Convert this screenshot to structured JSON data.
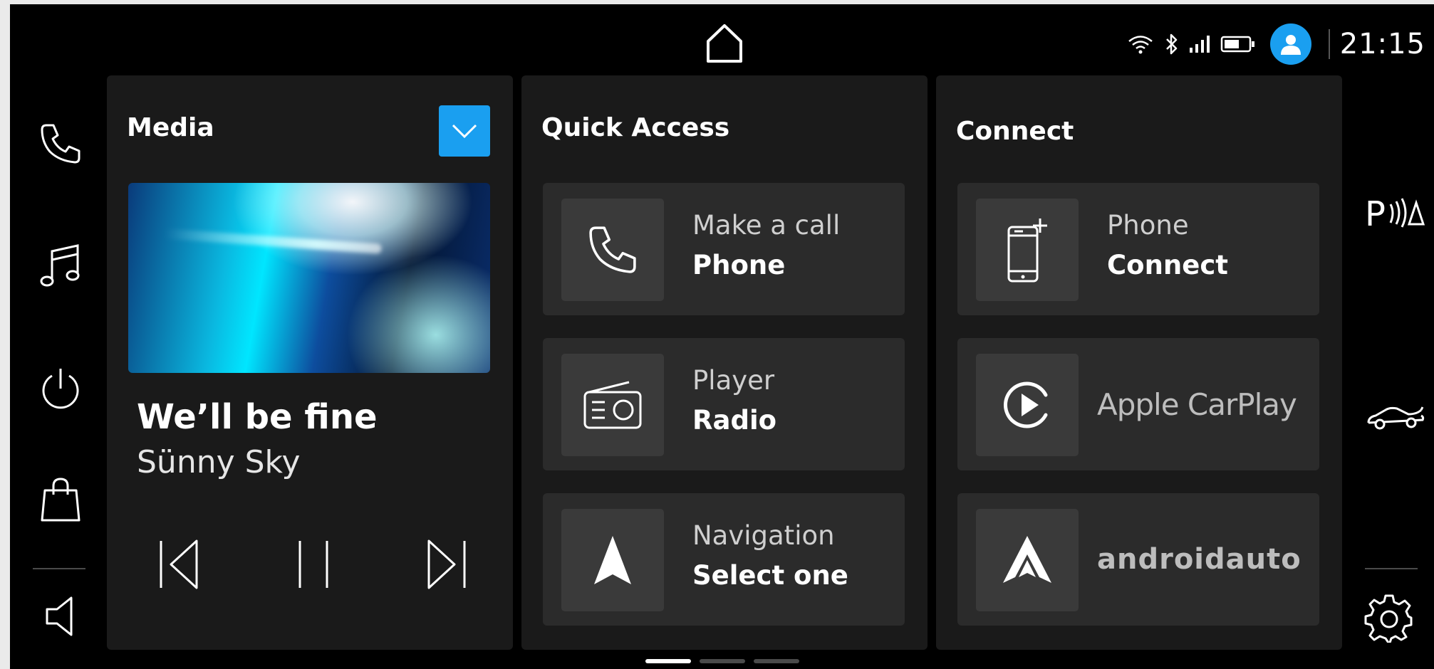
{
  "status": {
    "time": "21:15",
    "icons": [
      "wifi-icon",
      "bluetooth-icon",
      "cellular-signal-icon",
      "battery-icon",
      "user-avatar-icon"
    ]
  },
  "nav": {
    "home_icon": "home-icon",
    "left_rail": [
      "phone-icon",
      "music-note-icon",
      "power-icon",
      "shopping-bag-icon",
      "volume-icon"
    ],
    "right_rail": [
      "park-assist-icon",
      "car-icon",
      "gear-icon"
    ]
  },
  "media": {
    "title": "Media",
    "track_title": "We’ll be fine",
    "artist": "Sünny Sky",
    "controls": [
      "previous-track-icon",
      "pause-icon",
      "next-track-icon"
    ]
  },
  "quick_access": {
    "title": "Quick Access",
    "tiles": [
      {
        "line1": "Make a call",
        "line2": "Phone",
        "icon": "phone-icon"
      },
      {
        "line1": "Player",
        "line2": "Radio",
        "icon": "radio-icon"
      },
      {
        "line1": "Navigation",
        "line2": "Select one",
        "icon": "navigation-arrow-icon"
      }
    ]
  },
  "connect": {
    "title": "Connect",
    "tiles": [
      {
        "line1": "Phone",
        "line2": "Connect",
        "icon": "phone-add-icon"
      },
      {
        "label": "Apple CarPlay",
        "icon": "carplay-icon"
      },
      {
        "label": "androidauto",
        "icon": "android-auto-icon"
      }
    ]
  },
  "pager": {
    "pages": 3,
    "active": 1
  },
  "colors": {
    "accent": "#1a9ff0",
    "background": "#000000",
    "card": "#1a1a1a",
    "tile": "#2b2b2b"
  }
}
